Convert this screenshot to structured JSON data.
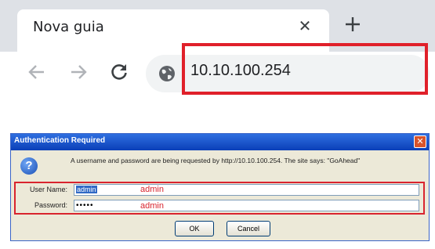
{
  "browser": {
    "tab": {
      "title": "Nova guia",
      "close_icon": "close-icon"
    },
    "new_tab_icon": "plus-icon",
    "toolbar": {
      "back_icon": "arrow-left-icon",
      "forward_icon": "arrow-right-icon",
      "reload_icon": "reload-icon",
      "site_info_icon": "globe-icon"
    },
    "address_bar": {
      "value": "10.10.100.254"
    },
    "highlight_color": "#e0202a"
  },
  "dialog": {
    "title": "Authentication Required",
    "close_symbol": "✕",
    "help_symbol": "?",
    "message": "A username and password are being requested by http://10.10.100.254. The site says: \"GoAhead\"",
    "username_label": "User Name:",
    "username_value": "admin",
    "password_label": "Password:",
    "password_value": "•••••",
    "annotation_username": "admin",
    "annotation_password": "admin",
    "ok_label": "OK",
    "cancel_label": "Cancel",
    "titlebar_color": "#0a3fb8",
    "annotation_color": "#d9242e"
  }
}
